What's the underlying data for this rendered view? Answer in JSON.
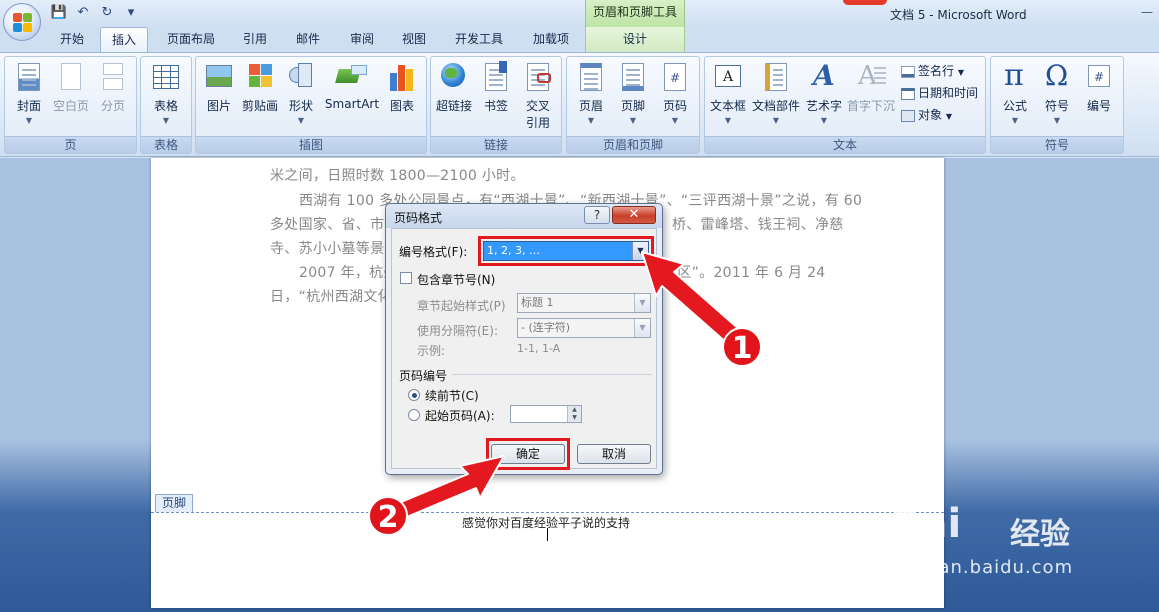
{
  "colors": {
    "highlight_red": "#e3191f",
    "selection_blue": "#3399ff",
    "context_tab_green": "#d2eac3"
  },
  "window": {
    "title": "文档 5 - Microsoft Word",
    "context_tool_title": "页眉和页脚工具"
  },
  "tabs": [
    "开始",
    "插入",
    "页面布局",
    "引用",
    "邮件",
    "审阅",
    "视图",
    "开发工具",
    "加载项",
    "设计"
  ],
  "active_tab": "插入",
  "ribbon": {
    "page_group": {
      "label": "页",
      "items": [
        "封面",
        "空白页",
        "分页"
      ]
    },
    "table_group": {
      "label": "表格",
      "items": [
        "表格"
      ]
    },
    "illustrations_group": {
      "label": "插图",
      "items": [
        "图片",
        "剪贴画",
        "形状",
        "SmartArt",
        "图表"
      ]
    },
    "links_group": {
      "label": "链接",
      "items": [
        "超链接",
        "书签",
        "交叉",
        "引用"
      ]
    },
    "header_footer_group": {
      "label": "页眉和页脚",
      "items": [
        "页眉",
        "页脚",
        "页码"
      ]
    },
    "text_group": {
      "label": "文本",
      "items": [
        "文本框",
        "文档部件",
        "艺术字",
        "首字下沉"
      ],
      "small_items": [
        "签名行",
        "日期和时间",
        "对象"
      ]
    },
    "symbols_group": {
      "label": "符号",
      "items": [
        "公式",
        "符号",
        "编号"
      ]
    }
  },
  "document": {
    "lines": [
      "米之间，日照时数 1800—2100 小时。",
      "西湖有 100 多处公园景点，有“西湖十景”、“新西湖十景”、“三评西湖十景”之说，有 60",
      "多处国家、省、市级",
      "桥、雷峰塔、钱王祠、净慈",
      "寺、苏小小墓等景点",
      "2007 年，杭州",
      "景区”。2011 年 6 月 24",
      "日，“杭州西湖文化"
    ],
    "footer_tab": "页脚",
    "footer_text": "感觉你对百度经验平子说的支持"
  },
  "dialog": {
    "title": "页码格式",
    "help": "?",
    "close": "✕",
    "number_format_label": "编号格式(F):",
    "number_format_value": "1, 2, 3, …",
    "include_chapter_label": "包含章节号(N)",
    "chapter_style_label": "章节起始样式(P)",
    "chapter_style_value": "标题 1",
    "separator_label": "使用分隔符(E):",
    "separator_value": "-   (连字符)",
    "example_label": "示例:",
    "example_value": "1-1, 1-A",
    "page_numbering_label": "页码编号",
    "continue_label": "续前节(C)",
    "start_at_label": "起始页码(A):",
    "ok": "确定",
    "cancel": "取消"
  },
  "annotations": {
    "badge1": "1",
    "badge2": "2"
  },
  "watermark": {
    "logo": "Bai",
    "cn": "经验",
    "url": "jingyan.baidu.com"
  }
}
